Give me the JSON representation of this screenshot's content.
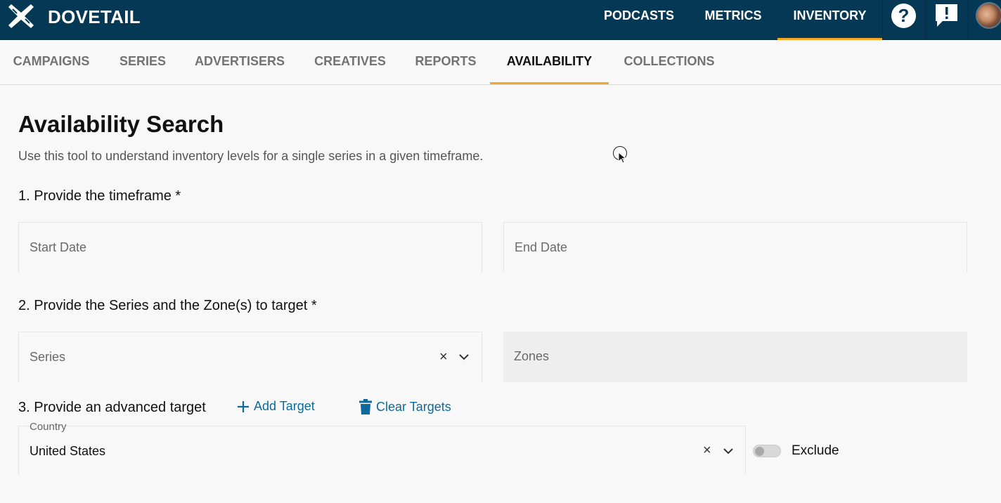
{
  "app": {
    "brand": "DOVETAIL",
    "top_nav": [
      {
        "label": "PODCASTS",
        "active": false
      },
      {
        "label": "METRICS",
        "active": false
      },
      {
        "label": "INVENTORY",
        "active": true
      }
    ],
    "icons": {
      "help": "help-icon",
      "feedback": "feedback-icon",
      "avatar": "user-avatar"
    }
  },
  "subnav": [
    {
      "label": "CAMPAIGNS",
      "active": false
    },
    {
      "label": "SERIES",
      "active": false
    },
    {
      "label": "ADVERTISERS",
      "active": false
    },
    {
      "label": "CREATIVES",
      "active": false
    },
    {
      "label": "REPORTS",
      "active": false
    },
    {
      "label": "AVAILABILITY",
      "active": true
    },
    {
      "label": "COLLECTIONS",
      "active": false
    }
  ],
  "page": {
    "title": "Availability Search",
    "description": "Use this tool to understand inventory levels for a single series in a given timeframe."
  },
  "step1": {
    "label": "1. Provide the timeframe *",
    "start_placeholder": "Start Date",
    "end_placeholder": "End Date"
  },
  "step2": {
    "label": "2. Provide the Series and the Zone(s) to target *",
    "series_placeholder": "Series",
    "zones_placeholder": "Zones",
    "clear_symbol": "×"
  },
  "step3": {
    "label": "3. Provide an advanced target",
    "add_target": "Add Target",
    "clear_targets": "Clear Targets",
    "target_field_label": "Country",
    "target_value": "United States",
    "clear_symbol": "×",
    "exclude_label": "Exclude",
    "exclude_on": false
  },
  "colors": {
    "top_bar": "#043855",
    "accent": "#f5a623",
    "link": "#0b6a9b"
  }
}
